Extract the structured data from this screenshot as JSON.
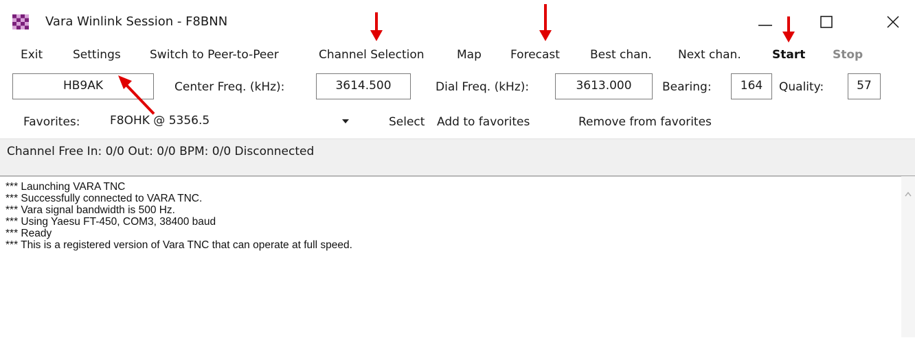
{
  "window": {
    "title": "Vara Winlink Session - F8BNN",
    "controls": {
      "minimize": "—",
      "maximize": "☐",
      "close": "✕"
    }
  },
  "menu": {
    "exit": "Exit",
    "settings": "Settings",
    "switch_p2p": "Switch to Peer-to-Peer",
    "channel_selection": "Channel Selection",
    "map": "Map",
    "forecast": "Forecast",
    "best_chan": "Best chan.",
    "next_chan": "Next chan.",
    "start": "Start",
    "stop": "Stop"
  },
  "station": {
    "callsign": "HB9AK",
    "center_freq_label": "Center Freq. (kHz):",
    "center_freq": "3614.500",
    "dial_freq_label": "Dial Freq. (kHz):",
    "dial_freq": "3613.000",
    "bearing_label": "Bearing:",
    "bearing": "164",
    "quality_label": "Quality:",
    "quality": "57"
  },
  "favorites": {
    "label": "Favorites:",
    "selected": "F8OHK  @  5356.5",
    "select": "Select",
    "add": "Add to favorites",
    "remove": "Remove from favorites"
  },
  "status": {
    "text": "Channel Free  In: 0/0  Out: 0/0  BPM: 0/0  Disconnected"
  },
  "log": [
    "*** Launching VARA TNC",
    "*** Successfully connected to VARA TNC.",
    "*** Vara signal bandwidth is 500 Hz.",
    "*** Using Yaesu FT-450, COM3, 38400 baud",
    "*** Ready",
    "*** This is a registered version of Vara TNC that can operate at full speed."
  ],
  "colors": {
    "annotation_arrow": "#e00000",
    "app_icon_purple": "#7a1f7a",
    "status_bg": "#f0f0f0",
    "disabled_text": "#8a8a8a"
  },
  "icons": {
    "app": "checkered-app-icon",
    "dropdown": "dropdown-arrow-icon",
    "scroll_up": "scroll-up-icon"
  }
}
